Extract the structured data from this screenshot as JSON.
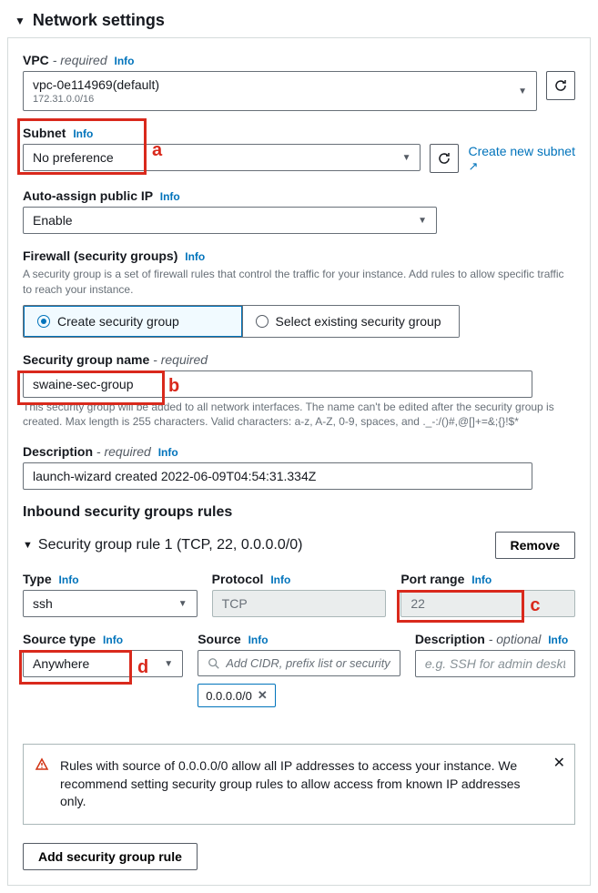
{
  "header": {
    "title": "Network settings"
  },
  "vpc": {
    "label": "VPC",
    "required": "- required",
    "info": "Info",
    "value": "vpc-0e114969",
    "sub": "172.31.0.0/16",
    "suffix": "(default)"
  },
  "subnet": {
    "label": "Subnet",
    "info": "Info",
    "value": "No preference",
    "create_link": "Create new subnet"
  },
  "autoip": {
    "label": "Auto-assign public IP",
    "info": "Info",
    "value": "Enable"
  },
  "firewall": {
    "label": "Firewall (security groups)",
    "info": "Info",
    "help": "A security group is a set of firewall rules that control the traffic for your instance. Add rules to allow specific traffic to reach your instance.",
    "create_label": "Create security group",
    "select_label": "Select existing security group"
  },
  "sg_name": {
    "label": "Security group name",
    "required": "- required",
    "value": "swaine-sec-group",
    "help": "This security group will be added to all network interfaces. The name can't be edited after the security group is created. Max length is 255 characters. Valid characters: a-z, A-Z, 0-9, spaces, and ._-:/()#,@[]+=&;{}!$*"
  },
  "desc": {
    "label": "Description",
    "required": "- required",
    "info": "Info",
    "value": "launch-wizard created 2022-06-09T04:54:31.334Z"
  },
  "inbound_heading": "Inbound security groups rules",
  "rule1": {
    "title": "Security group rule 1 (TCP, 22, 0.0.0.0/0)",
    "remove": "Remove",
    "type": {
      "label": "Type",
      "info": "Info",
      "value": "ssh"
    },
    "protocol": {
      "label": "Protocol",
      "info": "Info",
      "value": "TCP"
    },
    "port": {
      "label": "Port range",
      "info": "Info",
      "value": "22"
    },
    "source_type": {
      "label": "Source type",
      "info": "Info",
      "value": "Anywhere"
    },
    "source": {
      "label": "Source",
      "info": "Info",
      "placeholder": "Add CIDR, prefix list or security",
      "chip": "0.0.0.0/0"
    },
    "rdesc": {
      "label": "Description",
      "optional": "- optional",
      "info": "Info",
      "placeholder": "e.g. SSH for admin desktop"
    }
  },
  "warning": {
    "text": "Rules with source of 0.0.0.0/0 allow all IP addresses to access your instance. We recommend setting security group rules to allow access from known IP addresses only."
  },
  "add_rule_btn": "Add security group rule",
  "annotations": {
    "a": "a",
    "b": "b",
    "c": "c",
    "d": "d"
  }
}
